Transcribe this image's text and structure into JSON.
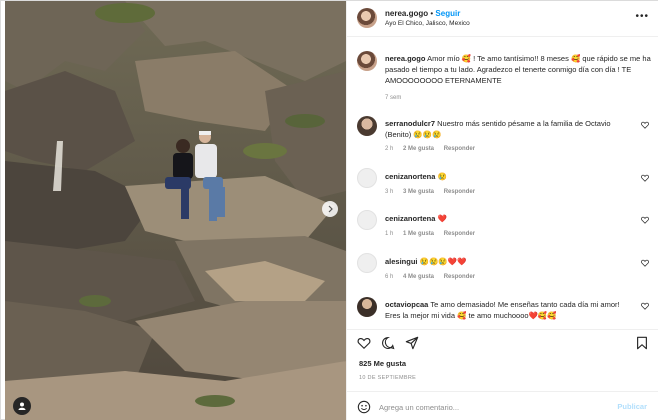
{
  "post": {
    "username": "nerea.gogo",
    "separator": "•",
    "follow_label": "Seguir",
    "location": "Ayo El Chico, Jalisco, Mexico",
    "more_icon": "more-horizontal-icon"
  },
  "caption": {
    "username": "nerea.gogo",
    "text": "Amor mío 🥰 ! Te amo tantísimo!! 8 meses 🥰 que rápido se me ha pasado el tiempo a tu lado. Agradezco el tenerte conmigo día con día ! TE AMOOOOOOOO ETERNAMENTE",
    "time": "7 sem"
  },
  "comments": [
    {
      "username": "serranodulcr7",
      "text": "Nuestro más sentido pésame a la familia de Octavio (Benito) 😢😢😢",
      "time": "2 h",
      "likes": "2 Me gusta",
      "reply": "Responder"
    },
    {
      "username": "cenizanortena",
      "text": "😢",
      "time": "3 h",
      "likes": "3 Me gusta",
      "reply": "Responder"
    },
    {
      "username": "cenizanortena",
      "text": "❤️",
      "time": "1 h",
      "likes": "1 Me gusta",
      "reply": "Responder"
    },
    {
      "username": "alesingui",
      "text": "😢😢😢❤️❤️",
      "time": "6 h",
      "likes": "4 Me gusta",
      "reply": "Responder"
    },
    {
      "username": "octaviopcaa",
      "text": "Te amo demasiado! Me enseñas tanto cada día mi amor! Eres la mejor mi vida 🥰 te amo muchoooo❤️🥰🥰",
      "time": "",
      "likes": "",
      "reply": ""
    }
  ],
  "footer": {
    "likes": "825 Me gusta",
    "date": "10 DE SEPTIEMBRE",
    "comment_placeholder": "Agrega un comentario...",
    "publish_label": "Publicar"
  },
  "colors": {
    "link_blue": "#0095f6",
    "publish_disabled": "#b2dffc",
    "meta_gray": "#8e8e8e",
    "text": "#262626"
  }
}
